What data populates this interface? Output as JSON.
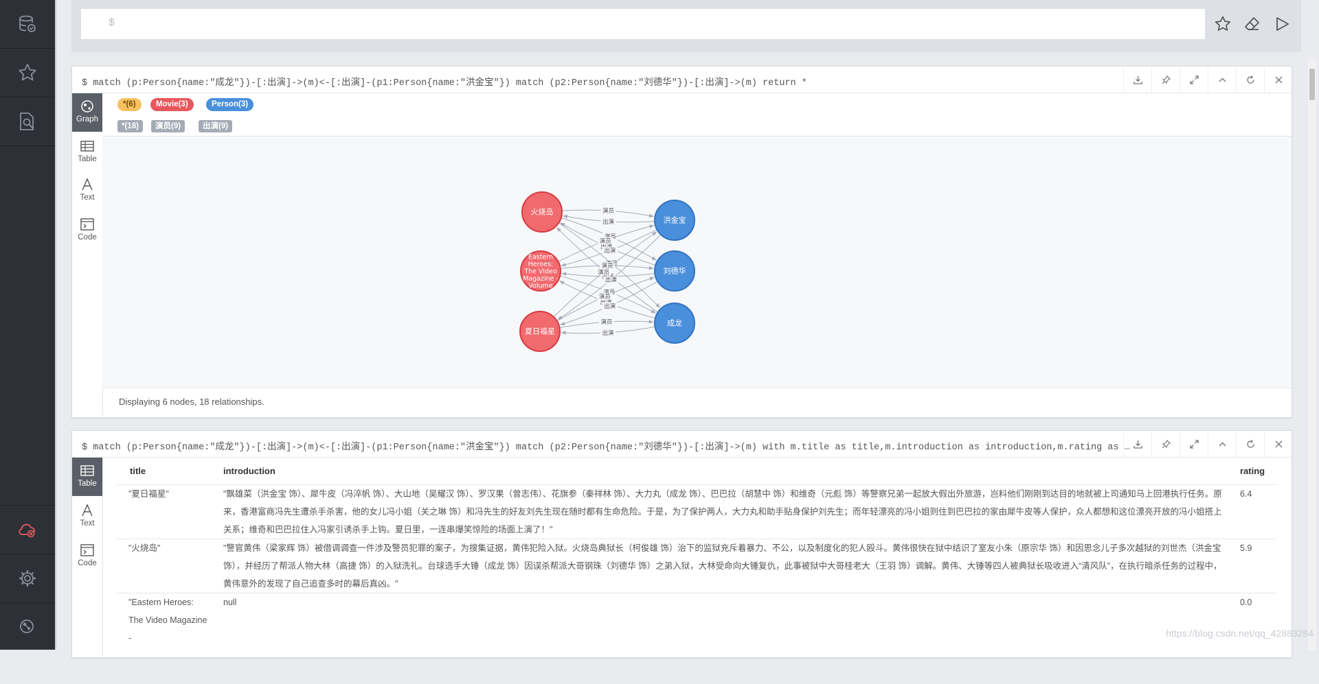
{
  "sidebar": {
    "items": [
      {
        "icon": "database-icon"
      },
      {
        "icon": "star-icon"
      },
      {
        "icon": "search-document-icon"
      },
      {
        "icon": "disconnected-cloud-icon"
      },
      {
        "icon": "gear-icon"
      },
      {
        "icon": "neo4j-about-icon"
      }
    ]
  },
  "editor": {
    "prompt": "$",
    "icons": [
      "star-icon",
      "eraser-icon",
      "play-icon"
    ]
  },
  "frame1": {
    "query": "$ match (p:Person{name:\"成龙\"})-[:出演]->(m)<-[:出演]-(p1:Person{name:\"洪金宝\"}) match (p2:Person{name:\"刘德华\"})-[:出演]->(m) return *",
    "tabs": [
      "Graph",
      "Table",
      "Text",
      "Code"
    ],
    "node_labels": [
      {
        "label": "*(6)",
        "color": "#f7c15f"
      },
      {
        "label": "Movie(3)",
        "color": "#e9575c"
      },
      {
        "label": "Person(3)",
        "color": "#4a8fdb"
      }
    ],
    "rel_types": [
      "*(18)",
      "演员(9)",
      "出演(9)"
    ],
    "nodes": [
      {
        "name": "火烧岛",
        "type": "Movie"
      },
      {
        "name": "Eastern Heroes: The Video Magazine - Volume",
        "type": "Movie",
        "lines": [
          "Eastern",
          "Heroes:",
          "The Video",
          "Magazine -",
          "Volume"
        ]
      },
      {
        "name": "夏日福星",
        "type": "Movie"
      },
      {
        "name": "洪金宝",
        "type": "Person"
      },
      {
        "name": "刘德华",
        "type": "Person"
      },
      {
        "name": "成龙",
        "type": "Person"
      }
    ],
    "edge_labels": {
      "actor": "演员",
      "acted_in": "出演"
    },
    "status": "Displaying 6 nodes, 18 relationships."
  },
  "frame2": {
    "query": "$ match (p:Person{name:\"成龙\"})-[:出演]->(m)<-[:出演]-(p1:Person{name:\"洪金宝\"}) match (p2:Person{name:\"刘德华\"})-[:出演]->(m) with m.title as title,m.introduction as introduction,m.rating as …",
    "tabs": [
      "Table",
      "Text",
      "Code"
    ],
    "columns": [
      "title",
      "introduction",
      "rating"
    ],
    "rows": [
      {
        "title": "\"夏日福星\"",
        "introduction": "\"飘雄菜（洪金宝 饰）、犀牛皮（冯淬帆 饰）、大山地（吴耀汉 饰）、罗汉果（曾志伟）、花旗参（秦祥林 饰）、大力丸（成龙 饰）、巴巴拉（胡慧中 饰）和维奇（元彪 饰）等警察兄弟一起放大假出外旅游，岂料他们刚刚到达目的地就被上司通知马上回港执行任务。原来，香港富商冯先生遭杀手杀害，他的女儿冯小姐（关之琳 饰）和冯先生的好友刘先生现在随时都有生命危险。于是，为了保护两人，大力丸和助手贴身保护刘先生；而年轻漂亮的冯小姐则住到巴巴拉的家由犀牛皮等人保护，众人都想和这位漂亮开放的冯小姐搭上关系；维奇和巴巴拉住入冯家引诱杀手上钩。夏日里，一连串爆笑惊险的场面上演了！\"",
        "rating": "6.4"
      },
      {
        "title": "\"火烧岛\"",
        "introduction": "\"警官黄伟（梁家辉 饰）被借调调查一件涉及警员犯罪的案子，为搜集证据，黄伟犯险入狱。火烧岛典狱长（柯俊雄 饰）治下的监狱充斥着暴力、不公，以及制度化的犯人殴斗。黄伟很快在狱中结识了室友小朱（原宗华 饰）和因思念儿子多次越狱的刘世杰（洪金宝 饰），并经历了帮派人物大林（高捷 饰）的入狱洗礼。台球选手大锤（成龙 饰）因误杀帮派大哥钢珠（刘德华 饰）之弟入狱，大林受命向大锤复仇，此事被狱中大哥桂老大（王羽 饰）调解。黄伟、大锤等四人被典狱长吸收进入“清风队”，在执行暗杀任务的过程中，黄伟意外的发现了自己追查多时的幕后真凶。\"",
        "rating": "5.9"
      },
      {
        "title": "\"Eastern Heroes: The Video Magazine -",
        "introduction": "null",
        "rating": "0.0"
      }
    ]
  },
  "frame_controls": [
    "download-icon",
    "pin-icon",
    "fullscreen-icon",
    "collapse-icon",
    "rerun-icon",
    "close-icon"
  ],
  "watermark": "https://blog.csdn.net/qq_42883284"
}
